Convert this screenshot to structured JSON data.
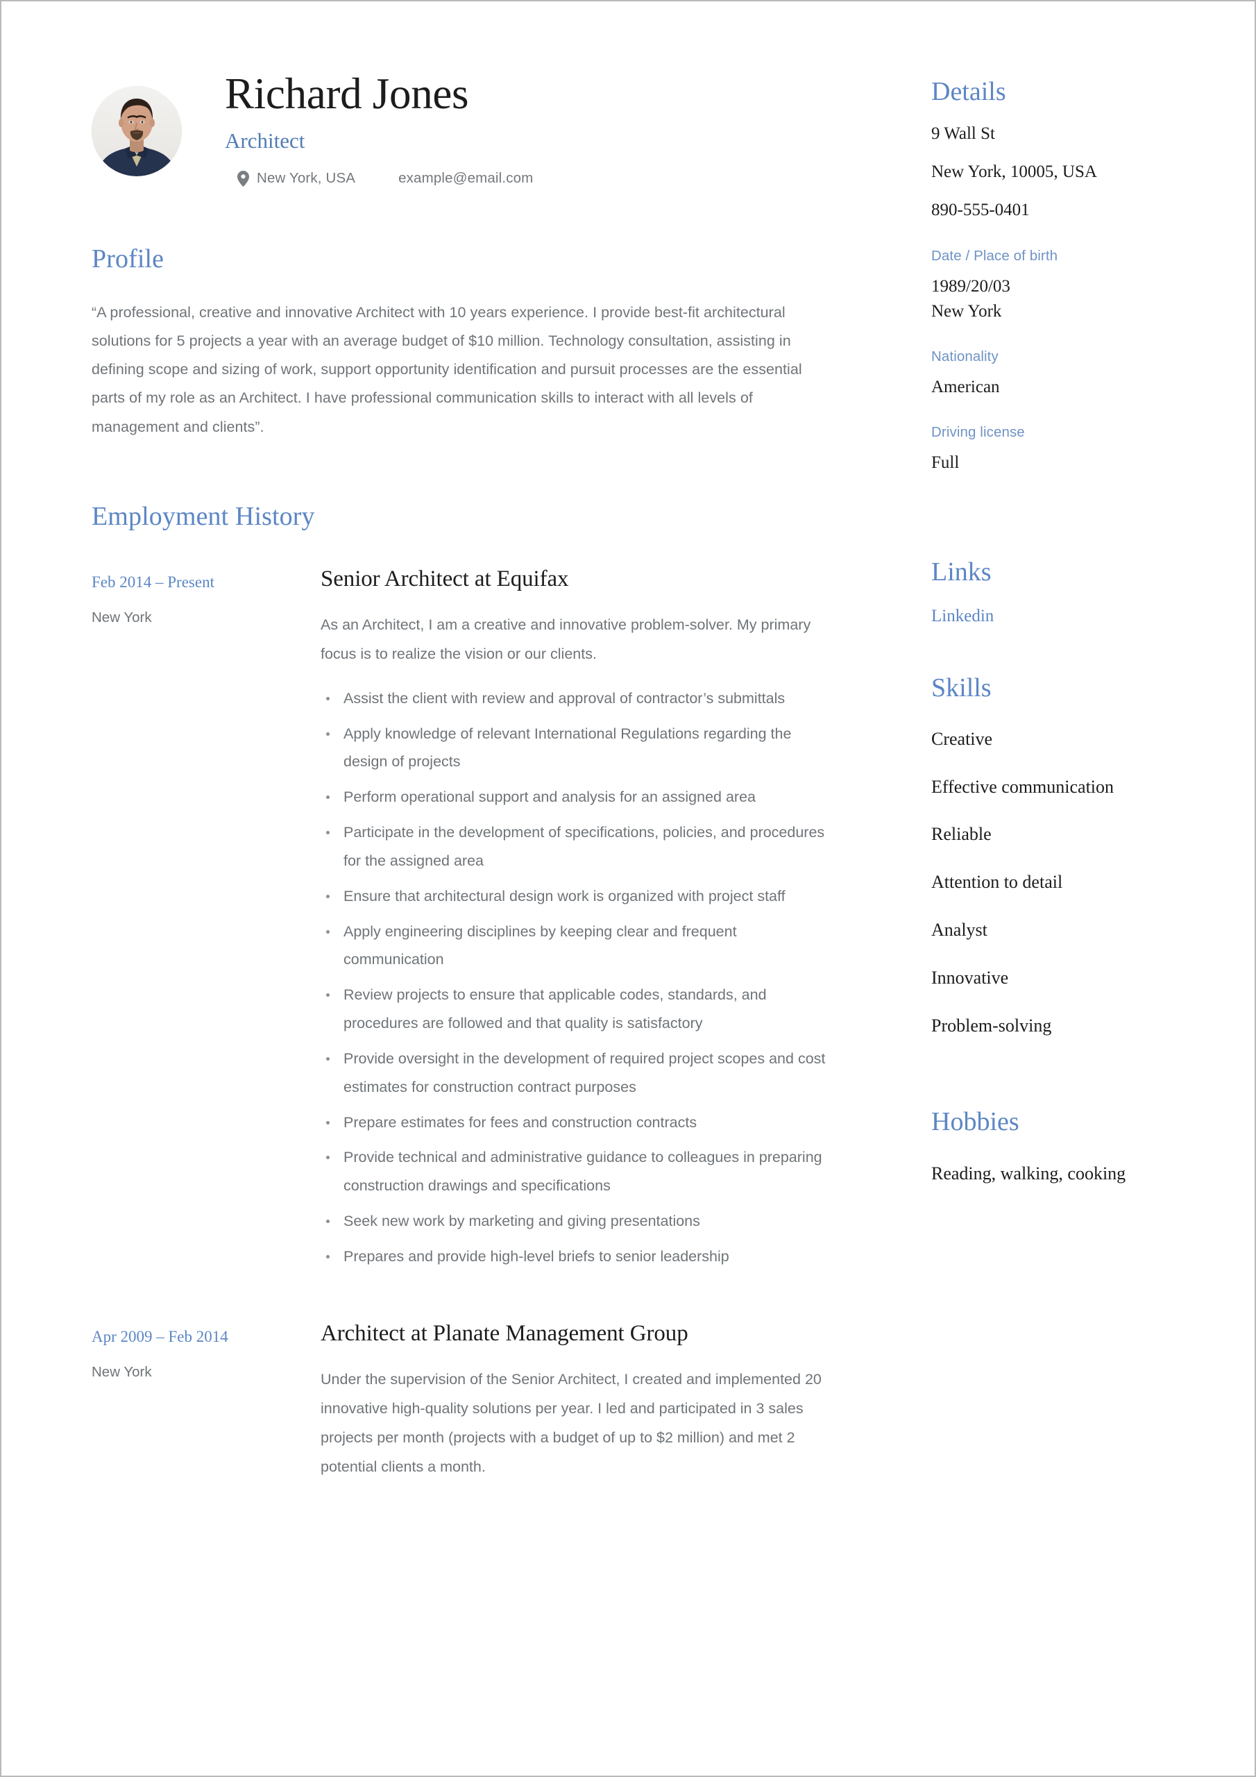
{
  "theme": {
    "accent": "#5c86c4",
    "accent_light": "#6f93c4",
    "text_dark": "#1c1c1c",
    "text_body": "#6f7478",
    "page_border": "#b9b9b9"
  },
  "header": {
    "name": "Richard Jones",
    "job_title": "Architect",
    "location_icon": "location-pin-icon",
    "location": "New York, USA",
    "email": "example@email.com",
    "avatar_alt": "portrait photo of man in navy blazer"
  },
  "profile": {
    "heading": "Profile",
    "body": "“A professional, creative and innovative Architect with 10 years experience. I provide best-fit architectural solutions for 5 projects a year with an average budget of $10 million. Technology consultation, assisting in defining scope and sizing of work, support opportunity identification and pursuit processes are the essential parts of my role as an Architect. I have professional communication skills to interact with all levels of management and clients”."
  },
  "employment": {
    "heading": "Employment History",
    "jobs": [
      {
        "dates": "Feb 2014 – Present",
        "location": "New York",
        "title": "Senior Architect at Equifax",
        "description": "As an Architect, I am a creative and innovative problem-solver. My primary focus is to realize the vision or our clients.",
        "bullets": [
          "Assist the client with review and approval of contractor’s submittals",
          "Apply knowledge of relevant International Regulations regarding the design of projects",
          "Perform operational support and analysis for an assigned area",
          "Participate in the development of specifications, policies, and procedures for the assigned area",
          "Ensure that architectural design work is organized with project staff",
          "Apply engineering disciplines by keeping clear and frequent communication",
          "Review projects to ensure that applicable codes, standards, and procedures are followed and that quality is satisfactory",
          "Provide oversight in the development of required project scopes and cost estimates for construction contract purposes",
          "Prepare estimates for fees and construction contracts",
          "Provide technical and administrative guidance to colleagues in preparing construction drawings and specifications",
          "Seek new work by marketing and giving presentations",
          "Prepares and provide high-level briefs to senior leadership"
        ]
      },
      {
        "dates": "Apr 2009 – Feb 2014",
        "location": "New York",
        "title": "Architect at Planate Management Group",
        "description": "Under the supervision of the Senior Architect, I created and implemented 20 innovative high-quality solutions per year. I led and participated in 3 sales projects per month (projects with a budget of up to $2 million) and met 2 potential clients a month.",
        "bullets": []
      }
    ]
  },
  "details": {
    "heading": "Details",
    "address_line1": "9 Wall St",
    "address_line2": "New York, 10005, USA",
    "phone": "890-555-0401",
    "dob_label": "Date / Place of birth",
    "dob_value": "1989/20/03\nNew York",
    "nationality_label": "Nationality",
    "nationality_value": "American",
    "license_label": "Driving license",
    "license_value": "Full"
  },
  "links": {
    "heading": "Links",
    "items": [
      "Linkedin"
    ]
  },
  "skills": {
    "heading": "Skills",
    "items": [
      "Creative",
      "Effective communication",
      "Reliable",
      "Attention to detail",
      "Analyst",
      "Innovative",
      "Problem-solving"
    ]
  },
  "hobbies": {
    "heading": "Hobbies",
    "text": "Reading, walking, cooking"
  }
}
